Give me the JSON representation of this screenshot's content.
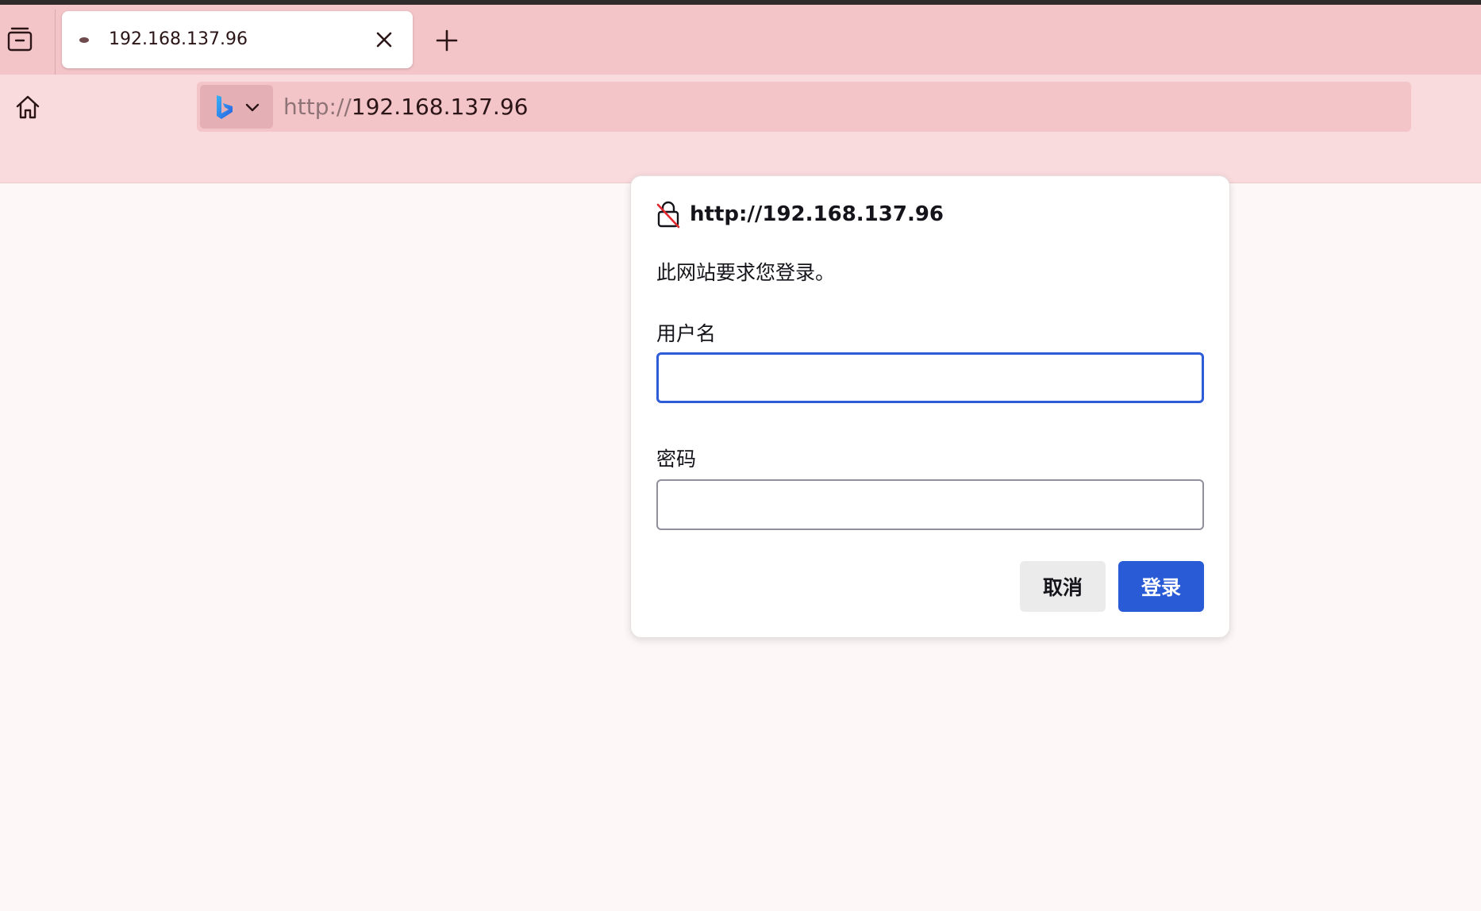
{
  "tab": {
    "title": "192.168.137.96"
  },
  "urlbar": {
    "scheme": "http://",
    "host": "192.168.137.96"
  },
  "dialog": {
    "origin": "http://192.168.137.96",
    "message": "此网站要求您登录。",
    "username_label": "用户名",
    "username_value": "",
    "password_label": "密码",
    "password_value": "",
    "cancel_label": "取消",
    "login_label": "登录"
  },
  "icons": {
    "tab_list": "tab-list-icon",
    "close": "close-icon",
    "new_tab": "plus-icon",
    "home": "home-icon",
    "search_engine": "bing-logo-icon",
    "chevron": "chevron-down-icon",
    "insecure_lock": "insecure-lock-icon"
  },
  "colors": {
    "tabbar_bg": "#f3c4c8",
    "navbar_bg": "#f9dadd",
    "accent": "#2a5bd7",
    "focus_border": "#2e5bd6"
  }
}
